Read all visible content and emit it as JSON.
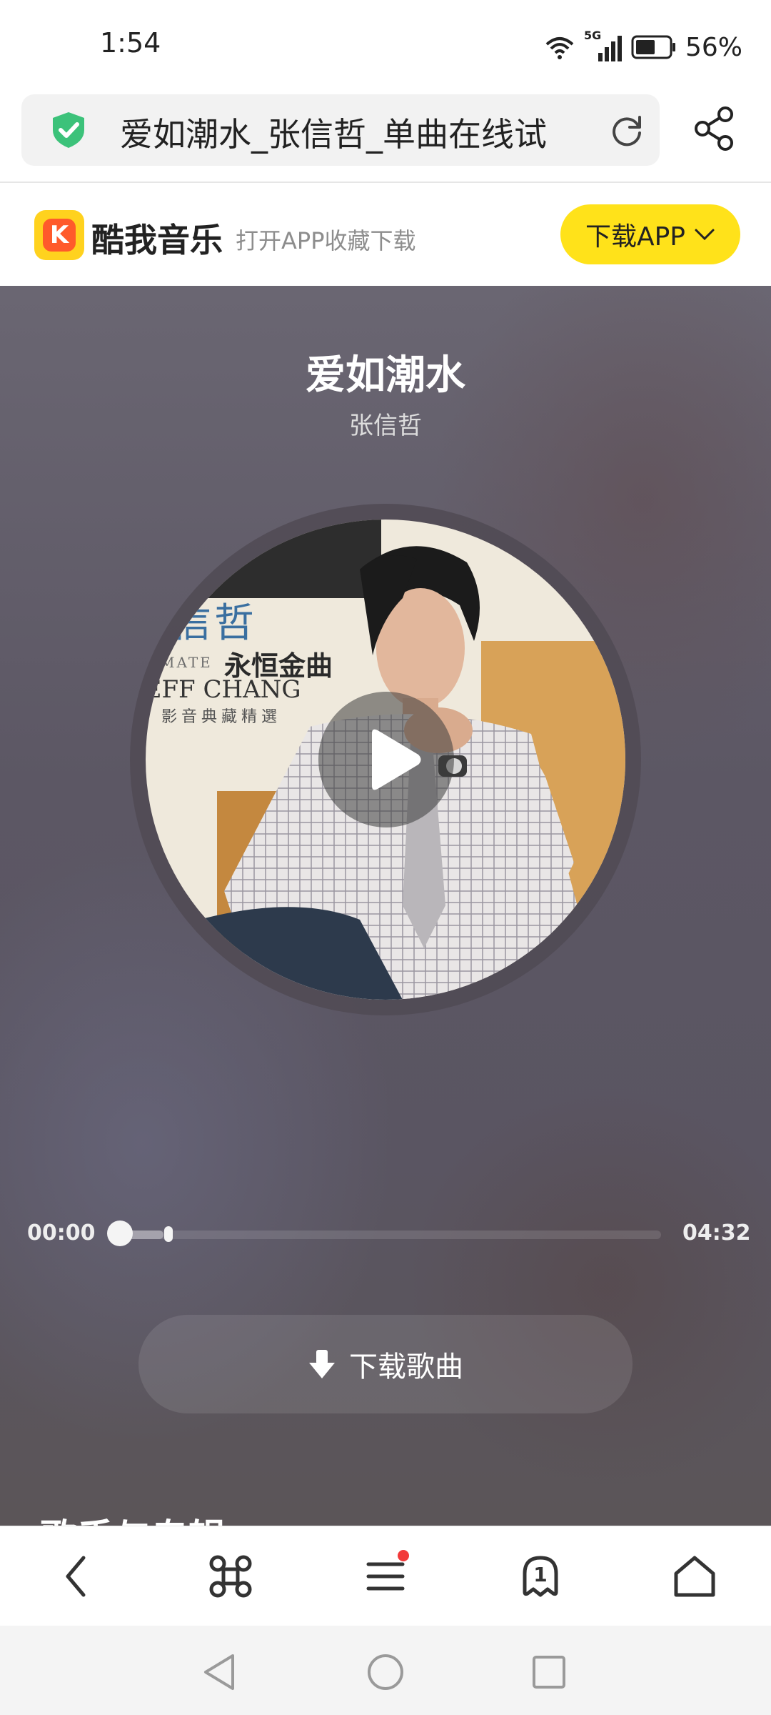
{
  "status_bar": {
    "time": "1:54",
    "network": "5G",
    "battery": "56%"
  },
  "url_bar": {
    "title": "爱如潮水_张信哲_单曲在线试"
  },
  "banner": {
    "app_name": "酷我音乐",
    "app_subtitle": "打开APP收藏下载",
    "download_app": "下载APP"
  },
  "player": {
    "song_title": "爱如潮水",
    "artist": "张信哲",
    "album_art": {
      "artist_name_cn": "张信哲",
      "collection_title": "永恒金曲",
      "artist_name_en": "JEFF CHANG",
      "label_fragment": "MATE",
      "subtitle": "影音典藏精選"
    },
    "time_current": "00:00",
    "time_total": "04:32",
    "progress_fraction": 0.0,
    "buffered_fraction": 0.08,
    "download_song": "下载歌曲",
    "next_section_peek": "歌手与专辑"
  },
  "colors": {
    "accent_yellow": "#ffe21a",
    "logo_orange": "#ff5a2b",
    "notification_red": "#f23a3a"
  },
  "toolbar": {
    "tab_count": "1"
  }
}
